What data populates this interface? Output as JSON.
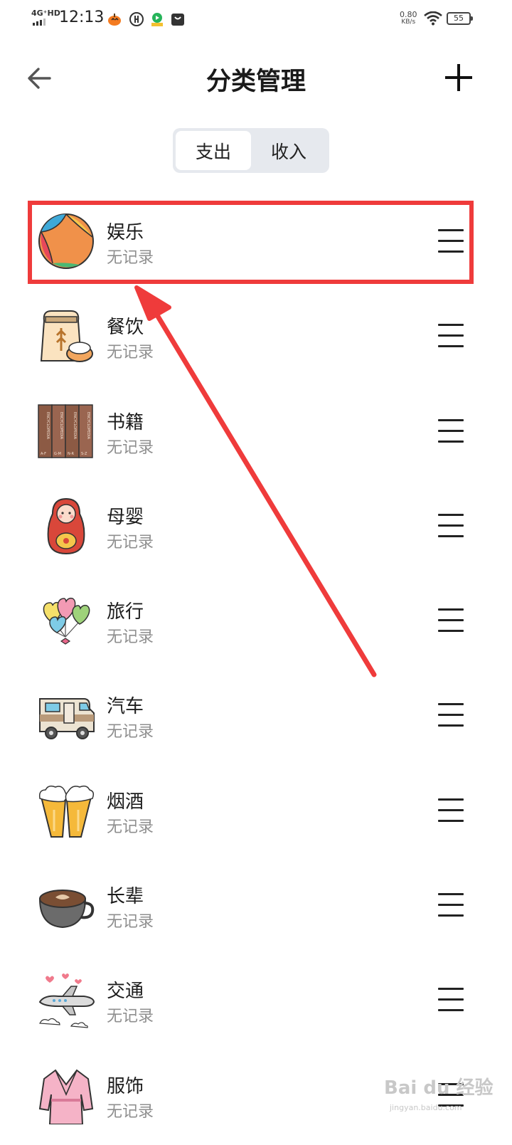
{
  "status_bar": {
    "network": "4G⁺HD",
    "time": "12:13",
    "speed_value": "0.80",
    "speed_unit": "KB/s",
    "battery": "55"
  },
  "header": {
    "title": "分类管理",
    "back_icon": "arrow-left-icon",
    "add_icon": "plus-icon"
  },
  "tabs": [
    {
      "label": "支出",
      "active": true
    },
    {
      "label": "收入",
      "active": false
    }
  ],
  "categories": [
    {
      "name": "娱乐",
      "status": "无记录",
      "icon": "beach-ball-icon"
    },
    {
      "name": "餐饮",
      "status": "无记录",
      "icon": "grain-bag-icon"
    },
    {
      "name": "书籍",
      "status": "无记录",
      "icon": "encyclopedia-books-icon"
    },
    {
      "name": "母婴",
      "status": "无记录",
      "icon": "matryoshka-doll-icon"
    },
    {
      "name": "旅行",
      "status": "无记录",
      "icon": "heart-balloons-icon"
    },
    {
      "name": "汽车",
      "status": "无记录",
      "icon": "camper-van-icon"
    },
    {
      "name": "烟酒",
      "status": "无记录",
      "icon": "beer-mugs-icon"
    },
    {
      "name": "长辈",
      "status": "无记录",
      "icon": "coffee-cup-icon"
    },
    {
      "name": "交通",
      "status": "无记录",
      "icon": "airplane-icon"
    },
    {
      "name": "服饰",
      "status": "无记录",
      "icon": "bathrobe-icon"
    }
  ],
  "book_spine_text": "ENCYCLOPEDIA",
  "book_volume_labels": [
    "A-F",
    "G-M",
    "N-R",
    "S-Z"
  ],
  "watermark": {
    "text": "Bai du 经验",
    "sub": "jingyan.baidu.com"
  },
  "colors": {
    "highlight": "#ef3b3b",
    "segment_bg": "#e6e9ee",
    "muted_text": "#8f8f8f"
  }
}
